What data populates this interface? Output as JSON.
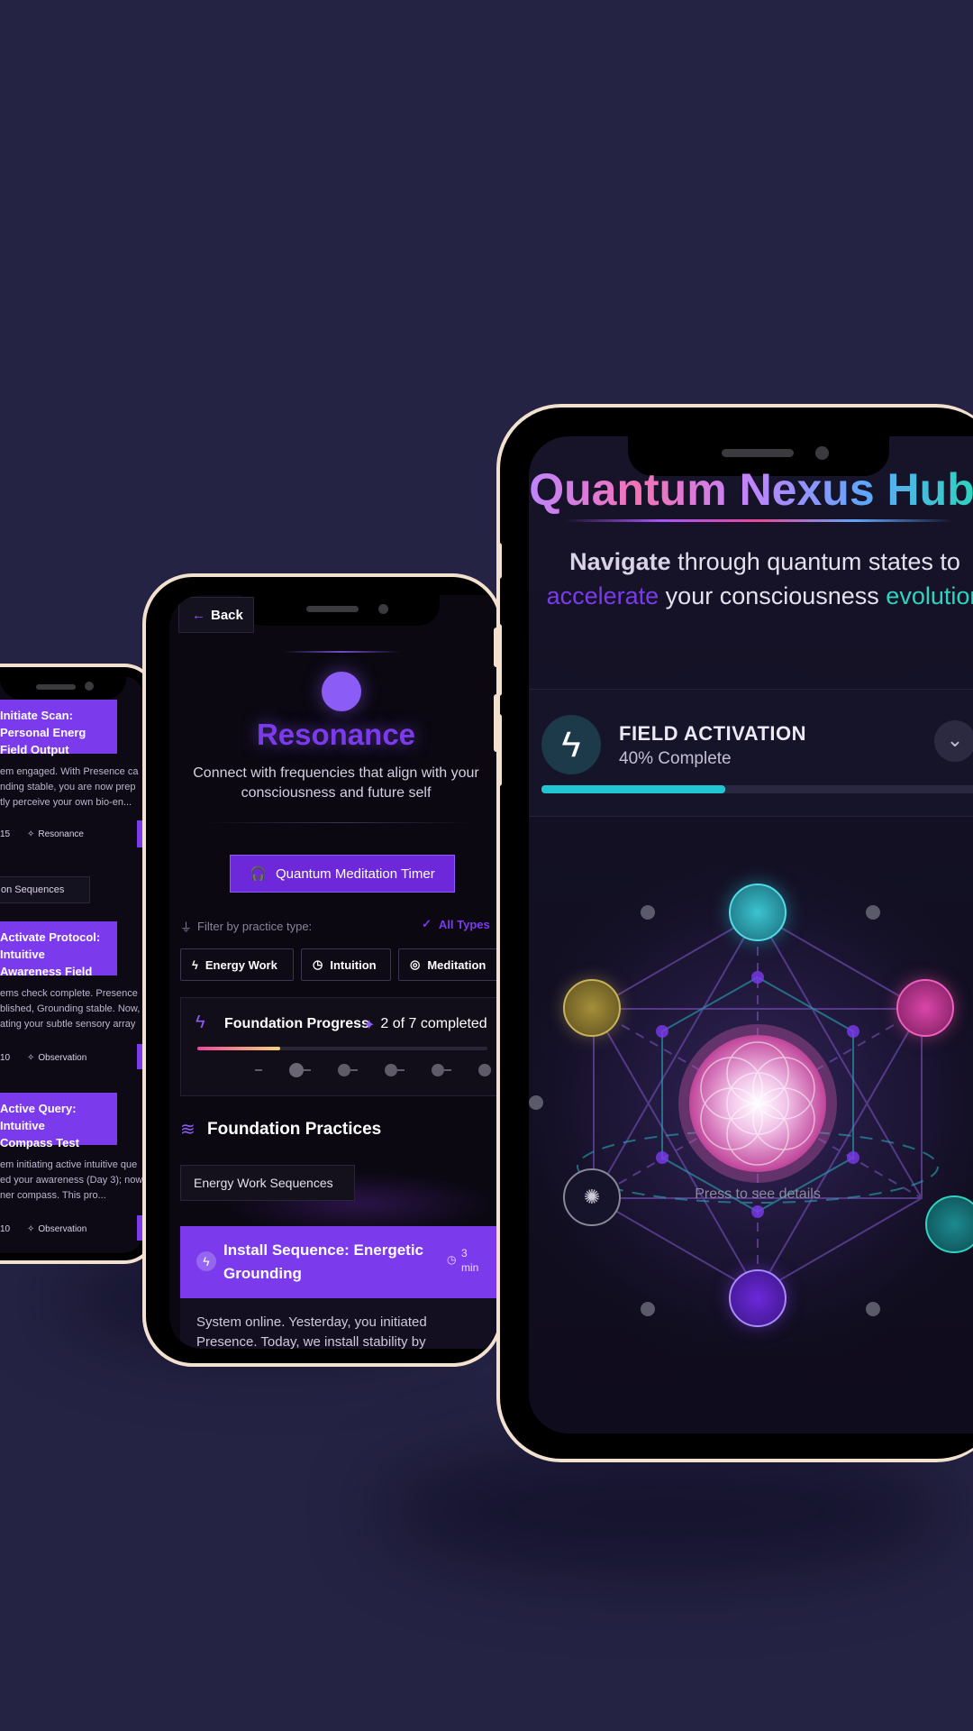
{
  "phone_left": {
    "card1": {
      "title_line1": "Initiate Scan: Personal Energ",
      "title_line2": "Field Output",
      "body": [
        "em engaged. With Presence ca",
        "nding stable, you are now prep",
        "tly perceive your own bio-en..."
      ],
      "count": "15",
      "tag": "Resonance"
    },
    "section": "on Sequences",
    "card2": {
      "title_line1": "Activate Protocol: Intuitive",
      "title_line2": "Awareness Field",
      "body": [
        "ems check complete. Presence",
        "blished, Grounding stable. Now,",
        "ating your subtle sensory array"
      ],
      "count": "10",
      "tag": "Observation"
    },
    "card3": {
      "title_line1": "Active Query: Intuitive",
      "title_line2": "Compass Test",
      "body": [
        "em initiating active intuitive que",
        "ed your awareness (Day 3); now",
        "ner compass. This pro..."
      ],
      "count": "10",
      "tag": "Observation"
    }
  },
  "phone_middle": {
    "back_label": "Back",
    "title": "Resonance",
    "subtitle_line1": "Connect with frequencies that align with your",
    "subtitle_line2": "consciousness and future self",
    "timer_button": "Quantum Meditation Timer",
    "filter_label": "Filter by practice type:",
    "all_types": "All Types",
    "filters": [
      "Energy Work",
      "Intuition",
      "Meditation"
    ],
    "progress": {
      "title": "Foundation Progress",
      "count_text": "2 of 7 completed",
      "fraction": 0.2857
    },
    "section_title": "Foundation Practices",
    "sequence_chip": "Energy Work Sequences",
    "practice": {
      "title_line1": "Install Sequence: Energetic",
      "title_line2": "Grounding",
      "duration_num": "3",
      "duration_unit": "min",
      "body_line1": "System online. Yesterday, you initiated",
      "body_line2": "Presence. Today, we install stability by"
    }
  },
  "phone_right": {
    "title": "Quantum Nexus Hub",
    "tagline": {
      "w1": "Navigate",
      "w2": " through quantum states to",
      "w3": "accelerate",
      "w4": " your consciousness ",
      "w5": "evolution"
    },
    "activation": {
      "title": "FIELD ACTIVATION",
      "status": "40% Complete",
      "progress": 0.4
    },
    "hint": "Press to see details"
  },
  "colors": {
    "background": "#252343",
    "accent_purple": "#7c3aed",
    "accent_cyan": "#22c6d3",
    "frame": "#f3e1cf"
  }
}
